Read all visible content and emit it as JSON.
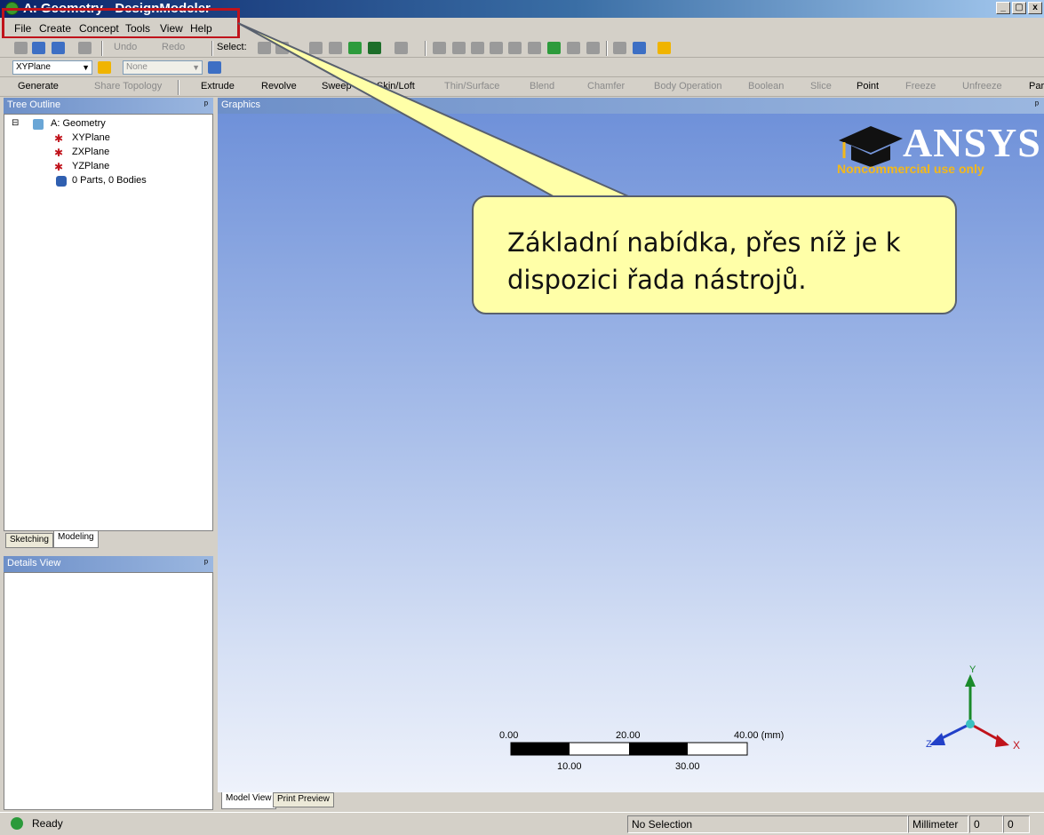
{
  "window": {
    "title": "A: Geometry - DesignModeler",
    "buttons": [
      "_",
      "▢",
      "x"
    ]
  },
  "menu": {
    "items": [
      "File",
      "Create",
      "Concept",
      "Tools",
      "View",
      "Help"
    ]
  },
  "toolbar1": {
    "undo": "Undo",
    "redo": "Redo",
    "select_label": "Select:"
  },
  "toolbar2": {
    "plane_value": "XYPlane",
    "sketch_value": "None"
  },
  "toolbar3": {
    "generate": "Generate",
    "share_topology": "Share Topology",
    "extrude": "Extrude",
    "revolve": "Revolve",
    "sweep": "Sweep",
    "loft": "Skin/Loft",
    "thin": "Thin/Surface",
    "blend": "Blend",
    "chamfer": "Chamfer",
    "body_operation": "Body Operation",
    "boolean": "Boolean",
    "slice": "Slice",
    "point": "Point",
    "freeze": "Freeze",
    "unfreeze": "Unfreeze",
    "parameters": "Parameters"
  },
  "tree": {
    "header": "Tree Outline",
    "items": [
      "A: Geometry",
      "XYPlane",
      "ZXPlane",
      "YZPlane",
      "0 Parts, 0 Bodies"
    ],
    "tabs": [
      "Sketching",
      "Modeling"
    ]
  },
  "details": {
    "header": "Details View"
  },
  "graphics": {
    "header": "Graphics",
    "logo_text": "ANSYS",
    "logo_sub": "Noncommercial use only",
    "callout": "Základní nabídka, přes níž je k dispozici řada nástrojů.",
    "scale_top": [
      "0.00",
      "20.00",
      "40.00 (mm)"
    ],
    "scale_bottom": [
      "10.00",
      "30.00"
    ],
    "axis": {
      "x": "X",
      "y": "Y",
      "z": "Z"
    },
    "tabs": [
      "Model View",
      "Print Preview"
    ]
  },
  "status": {
    "ready": "Ready",
    "selection": "No Selection",
    "units": "Millimeter",
    "val1": "0",
    "val2": "0"
  },
  "colors": {
    "accent": "#c0131b",
    "callout_bg": "#ffffa8"
  }
}
